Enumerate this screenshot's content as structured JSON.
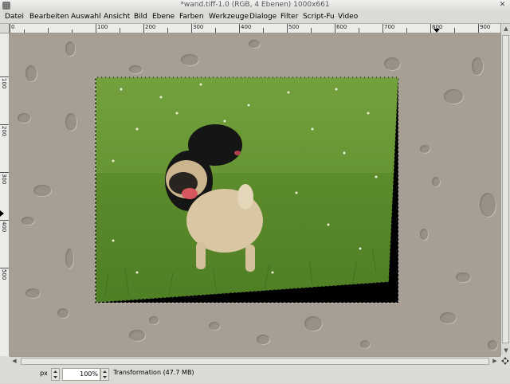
{
  "window": {
    "title": "*wand.tiff-1.0 (RGB, 4 Ebenen) 1000x661",
    "close_glyph": "✕",
    "icon": "gimp-window-icon"
  },
  "menubar": {
    "items": [
      {
        "label": "Datei"
      },
      {
        "label": "Bearbeiten"
      },
      {
        "label": "Auswahl"
      },
      {
        "label": "Ansicht"
      },
      {
        "label": "Bild"
      },
      {
        "label": "Ebene"
      },
      {
        "label": "Farben"
      },
      {
        "label": "Werkzeuge"
      },
      {
        "label": "Dialoge"
      },
      {
        "label": "Filter"
      },
      {
        "label": "Script-Fu"
      },
      {
        "label": "Video"
      }
    ]
  },
  "ruler_h": {
    "labels": [
      "0",
      "100",
      "200",
      "300",
      "400",
      "500",
      "600",
      "700",
      "800",
      "900"
    ]
  },
  "ruler_v": {
    "labels": [
      "100",
      "200",
      "300",
      "400",
      "500"
    ]
  },
  "canvas": {
    "background_color": "#a89f94",
    "image_description_icon": "pug-photo-layer"
  },
  "statusbar": {
    "unit": "px",
    "zoom": "100%",
    "message": "Transformation (47.7 MB)"
  },
  "colors": {
    "chrome": "#dcdad5",
    "grass": "#5c8a2c",
    "shadow": "#000000"
  }
}
